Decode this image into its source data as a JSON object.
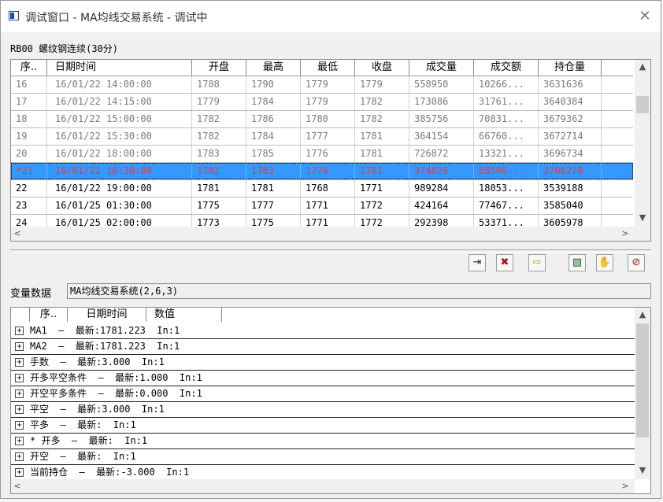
{
  "window": {
    "title": "调试窗口 - MA均线交易系统 - 调试中",
    "close_glyph": "✕"
  },
  "caption": "RB00 螺纹钢连续(30分)",
  "grid": {
    "columns": [
      "序..",
      "日期时间",
      "开盘",
      "最高",
      "最低",
      "收盘",
      "成交量",
      "成交额",
      "持仓量"
    ],
    "rows": [
      {
        "idx": "16",
        "dt": "16/01/22 14:00:00",
        "open": "1788",
        "high": "1790",
        "low": "1779",
        "close": "1779",
        "vol": "558950",
        "amt": "10266...",
        "oi": "3631636",
        "style": "gray"
      },
      {
        "idx": "17",
        "dt": "16/01/22 14:15:00",
        "open": "1779",
        "high": "1784",
        "low": "1779",
        "close": "1782",
        "vol": "173086",
        "amt": "31761...",
        "oi": "3640384",
        "style": "gray"
      },
      {
        "idx": "18",
        "dt": "16/01/22 15:00:00",
        "open": "1782",
        "high": "1786",
        "low": "1780",
        "close": "1782",
        "vol": "385756",
        "amt": "70831...",
        "oi": "3679362",
        "style": "gray"
      },
      {
        "idx": "19",
        "dt": "16/01/22 15:30:00",
        "open": "1782",
        "high": "1784",
        "low": "1777",
        "close": "1781",
        "vol": "364154",
        "amt": "66760...",
        "oi": "3672714",
        "style": "gray"
      },
      {
        "idx": "20",
        "dt": "16/01/22 18:00:00",
        "open": "1783",
        "high": "1785",
        "low": "1776",
        "close": "1781",
        "vol": "726872",
        "amt": "13321...",
        "oi": "3696734",
        "style": "gray"
      },
      {
        "idx": "*21",
        "dt": "16/01/22 18:30:00",
        "open": "1782",
        "high": "1783",
        "low": "1778",
        "close": "1781",
        "vol": "374026",
        "amt": "68596...",
        "oi": "3706278",
        "style": "sel"
      },
      {
        "idx": "22",
        "dt": "16/01/22 19:00:00",
        "open": "1781",
        "high": "1781",
        "low": "1768",
        "close": "1771",
        "vol": "989284",
        "amt": "18053...",
        "oi": "3539188",
        "style": "black"
      },
      {
        "idx": "23",
        "dt": "16/01/25 01:30:00",
        "open": "1775",
        "high": "1777",
        "low": "1771",
        "close": "1772",
        "vol": "424164",
        "amt": "77467...",
        "oi": "3585040",
        "style": "black"
      },
      {
        "idx": "24",
        "dt": "16/01/25 02:00:00",
        "open": "1773",
        "high": "1775",
        "low": "1771",
        "close": "1772",
        "vol": "292398",
        "amt": "53371...",
        "oi": "3605978",
        "style": "black"
      }
    ]
  },
  "toolbar": {
    "buttons": [
      {
        "icon": "step-into-icon",
        "glyph": "⇥"
      },
      {
        "icon": "clear-breakpoints-icon",
        "glyph": "✖"
      },
      {
        "icon": "next-arrow-icon",
        "glyph": "⇨"
      },
      {
        "icon": "chart-window-icon",
        "glyph": "▧"
      },
      {
        "icon": "hand-icon",
        "glyph": "✋"
      },
      {
        "icon": "stop-hand-icon",
        "glyph": "⊘"
      }
    ]
  },
  "variables": {
    "label": "变量数据",
    "system": "MA均线交易系统(2,6,3)",
    "columns": [
      "序..",
      "日期时间",
      "数值"
    ],
    "items": [
      {
        "expander": "+",
        "text": "MA1  –  最新:1781.223  In:1"
      },
      {
        "expander": "+",
        "text": "MA2  –  最新:1781.223  In:1"
      },
      {
        "expander": "+",
        "text": "手数  –  最新:3.000  In:1"
      },
      {
        "expander": "+",
        "text": "开多平空条件  –  最新:1.000  In:1"
      },
      {
        "expander": "+",
        "text": "开空平多条件  –  最新:0.000  In:1"
      },
      {
        "expander": "+",
        "text": "平空  –  最新:3.000  In:1"
      },
      {
        "expander": "+",
        "text": "平多  –  最新:  In:1"
      },
      {
        "expander": "+",
        "text": "* 开多  –  最新:  In:1"
      },
      {
        "expander": "+",
        "text": "开空  –  最新:  In:1"
      },
      {
        "expander": "+",
        "text": "当前持仓  –  最新:-3.000  In:1"
      }
    ]
  },
  "scroll_glyphs": {
    "up": "▲",
    "down": "▼",
    "left": "<",
    "right": ">"
  },
  "colors": {
    "selection": "#3399ff",
    "selected_text": "#ff3030"
  }
}
